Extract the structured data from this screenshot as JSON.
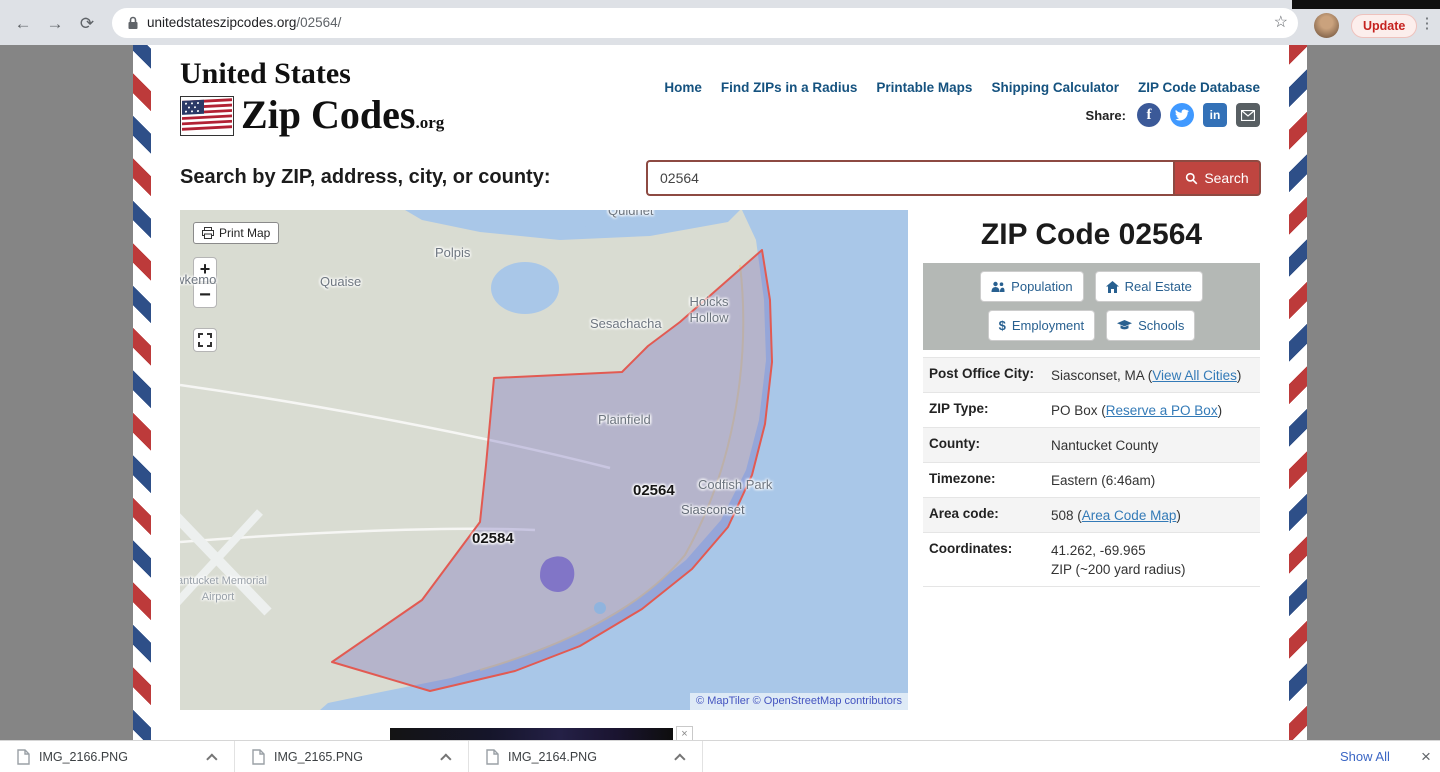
{
  "browser": {
    "url_domain": "unitedstateszipcodes.org",
    "url_path": "/02564/",
    "update_label": "Update"
  },
  "header": {
    "logo_line1": "United States",
    "logo_line2": "Zip Codes",
    "logo_tld": ".org",
    "nav": [
      {
        "label": "Home"
      },
      {
        "label": "Find ZIPs in a Radius"
      },
      {
        "label": "Printable Maps"
      },
      {
        "label": "Shipping Calculator"
      },
      {
        "label": "ZIP Code Database"
      }
    ],
    "share_label": "Share:"
  },
  "search": {
    "label": "Search by ZIP, address, city, or county:",
    "value": "02564",
    "button_label": "Search"
  },
  "map": {
    "print_button": "Print Map",
    "zoom_in": "+",
    "zoom_out": "−",
    "attribution": "© MapTiler © OpenStreetMap contributors",
    "labels": [
      {
        "text": "Quidnet"
      },
      {
        "text": "Polpis"
      },
      {
        "text": "Quaise"
      },
      {
        "text": "Shawkemo"
      },
      {
        "text": "Sesachacha"
      },
      {
        "text": "Hoicks Hollow"
      },
      {
        "text": "Plainfield"
      },
      {
        "text": "Codfish Park"
      },
      {
        "text": "Siasconset"
      },
      {
        "text": "Nantucket Memorial Airport"
      }
    ],
    "zip_labels": [
      {
        "text": "02564"
      },
      {
        "text": "02584"
      }
    ]
  },
  "panel": {
    "title": "ZIP Code 02564",
    "buttons": [
      {
        "label": "Population"
      },
      {
        "label": "Real Estate"
      },
      {
        "label": "Employment"
      },
      {
        "label": "Schools"
      }
    ],
    "rows": [
      {
        "label": "Post Office City:",
        "pre": "Siasconset, MA (",
        "link": "View All Cities",
        "post": ")",
        "line2": ""
      },
      {
        "label": "ZIP Type:",
        "pre": "PO Box (",
        "link": "Reserve a PO Box",
        "post": ")",
        "line2": ""
      },
      {
        "label": "County:",
        "pre": "Nantucket County",
        "link": "",
        "post": "",
        "line2": ""
      },
      {
        "label": "Timezone:",
        "pre": "Eastern (6:46am)",
        "link": "",
        "post": "",
        "line2": ""
      },
      {
        "label": "Area code:",
        "pre": "508 (",
        "link": "Area Code Map",
        "post": ")",
        "line2": ""
      },
      {
        "label": "Coordinates:",
        "pre": "41.262, -69.965",
        "link": "",
        "post": "",
        "line2": "ZIP (~200 yard radius)"
      }
    ]
  },
  "downloads": {
    "files": [
      {
        "name": "IMG_2166.PNG"
      },
      {
        "name": "IMG_2165.PNG"
      },
      {
        "name": "IMG_2164.PNG"
      }
    ],
    "show_all": "Show All"
  }
}
